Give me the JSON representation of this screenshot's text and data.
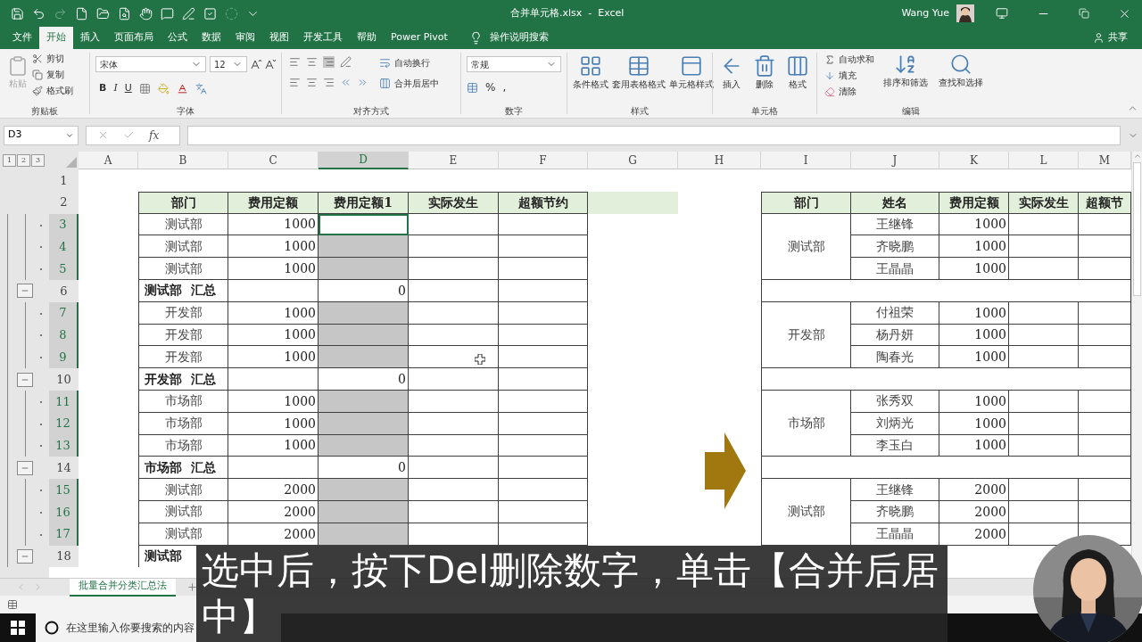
{
  "window": {
    "title": "合并单元格.xlsx  -  Excel",
    "user": "Wang Yue"
  },
  "ribbon_tabs": [
    {
      "label": "文件",
      "selected": false
    },
    {
      "label": "开始",
      "selected": true
    },
    {
      "label": "插入",
      "selected": false
    },
    {
      "label": "页面布局",
      "selected": false
    },
    {
      "label": "公式",
      "selected": false
    },
    {
      "label": "数据",
      "selected": false
    },
    {
      "label": "审阅",
      "selected": false
    },
    {
      "label": "视图",
      "selected": false
    },
    {
      "label": "开发工具",
      "selected": false
    },
    {
      "label": "帮助",
      "selected": false
    },
    {
      "label": "Power Pivot",
      "selected": false
    }
  ],
  "tell_me": "操作说明搜索",
  "share": "共享",
  "clipboard": {
    "title": "剪贴板",
    "paste": "粘贴",
    "commands": [
      "剪切",
      "复制",
      "格式刷"
    ]
  },
  "font": {
    "title": "字体",
    "family": "宋体",
    "size": "12",
    "styles": [
      "B",
      "I",
      "U"
    ]
  },
  "alignment": {
    "title": "对齐方式",
    "commands": [
      "自动换行",
      "合并后居中"
    ]
  },
  "number": {
    "title": "数字",
    "format": "常规",
    "symbols": [
      "%",
      ","
    ]
  },
  "styles": {
    "title": "样式",
    "commands": [
      "条件格式",
      "套用表格格式",
      "单元格样式"
    ]
  },
  "cells": {
    "title": "单元格",
    "commands": [
      "插入",
      "删除",
      "格式"
    ]
  },
  "editing": {
    "title": "编辑",
    "small": [
      "自动求和",
      "填充",
      "清除"
    ],
    "large": [
      "排序和筛选",
      "查找和选择"
    ]
  },
  "formula_bar": {
    "name_box": "D3",
    "fx": "fx"
  },
  "sheet": {
    "outline_levels": [
      "1",
      "2",
      "3"
    ],
    "columns": [
      {
        "label": "A",
        "selected": false
      },
      {
        "label": "B",
        "selected": false
      },
      {
        "label": "C",
        "selected": false
      },
      {
        "label": "D",
        "selected": true
      },
      {
        "label": "E",
        "selected": false
      },
      {
        "label": "F",
        "selected": false
      },
      {
        "label": "G",
        "selected": false
      },
      {
        "label": "H",
        "selected": false
      },
      {
        "label": "I",
        "selected": false
      },
      {
        "label": "J",
        "selected": false
      },
      {
        "label": "K",
        "selected": false
      },
      {
        "label": "L",
        "selected": false
      },
      {
        "label": "M",
        "selected": false
      }
    ],
    "rows": [
      {
        "number": "1",
        "selected": false
      },
      {
        "number": "2",
        "selected": false
      },
      {
        "number": "3",
        "selected": true,
        "kind": "detail"
      },
      {
        "number": "4",
        "selected": true,
        "kind": "detail"
      },
      {
        "number": "5",
        "selected": true,
        "kind": "detail"
      },
      {
        "number": "6",
        "selected": false,
        "kind": "collapse"
      },
      {
        "number": "7",
        "selected": true,
        "kind": "detail"
      },
      {
        "number": "8",
        "selected": true,
        "kind": "detail"
      },
      {
        "number": "9",
        "selected": true,
        "kind": "detail"
      },
      {
        "number": "10",
        "selected": false,
        "kind": "collapse"
      },
      {
        "number": "11",
        "selected": true,
        "kind": "detail"
      },
      {
        "number": "12",
        "selected": true,
        "kind": "detail"
      },
      {
        "number": "13",
        "selected": true,
        "kind": "detail"
      },
      {
        "number": "14",
        "selected": false,
        "kind": "collapse"
      },
      {
        "number": "15",
        "selected": true,
        "kind": "detail"
      },
      {
        "number": "16",
        "selected": true,
        "kind": "detail"
      },
      {
        "number": "17",
        "selected": true,
        "kind": "detail"
      },
      {
        "number": "18",
        "selected": false,
        "kind": "collapse"
      }
    ]
  },
  "left_table": {
    "header": [
      "部门",
      "费用定额",
      "费用定额1",
      "实际发生",
      "超额节约"
    ],
    "rows": [
      {
        "kind": "detail",
        "dept": "测试部",
        "quota": "1000",
        "quota1": "",
        "selected": true,
        "active": true
      },
      {
        "kind": "detail",
        "dept": "测试部",
        "quota": "1000",
        "quota1": "",
        "selected": true,
        "active": false
      },
      {
        "kind": "detail",
        "dept": "测试部",
        "quota": "1000",
        "quota1": "",
        "selected": true,
        "active": false
      },
      {
        "kind": "subtotal",
        "dept": "测试部  汇总",
        "quota": "",
        "quota1": "0",
        "selected": false,
        "active": false
      },
      {
        "kind": "detail",
        "dept": "开发部",
        "quota": "1000",
        "quota1": "",
        "selected": true,
        "active": false
      },
      {
        "kind": "detail",
        "dept": "开发部",
        "quota": "1000",
        "quota1": "",
        "selected": true,
        "active": false
      },
      {
        "kind": "detail",
        "dept": "开发部",
        "quota": "1000",
        "quota1": "",
        "selected": true,
        "active": false
      },
      {
        "kind": "subtotal",
        "dept": "开发部  汇总",
        "quota": "",
        "quota1": "0",
        "selected": false,
        "active": false
      },
      {
        "kind": "detail",
        "dept": "市场部",
        "quota": "1000",
        "quota1": "",
        "selected": true,
        "active": false
      },
      {
        "kind": "detail",
        "dept": "市场部",
        "quota": "1000",
        "quota1": "",
        "selected": true,
        "active": false
      },
      {
        "kind": "detail",
        "dept": "市场部",
        "quota": "1000",
        "quota1": "",
        "selected": true,
        "active": false
      },
      {
        "kind": "subtotal",
        "dept": "市场部  汇总",
        "quota": "",
        "quota1": "0",
        "selected": false,
        "active": false
      },
      {
        "kind": "detail",
        "dept": "测试部",
        "quota": "2000",
        "quota1": "",
        "selected": true,
        "active": false
      },
      {
        "kind": "detail",
        "dept": "测试部",
        "quota": "2000",
        "quota1": "",
        "selected": true,
        "active": false
      },
      {
        "kind": "detail",
        "dept": "测试部",
        "quota": "2000",
        "quota1": "",
        "selected": true,
        "active": false
      },
      {
        "kind": "partial",
        "dept": "测试部"
      }
    ]
  },
  "right_table": {
    "header": [
      "部门",
      "姓名",
      "费用定额",
      "实际发生",
      "超额节"
    ],
    "groups": [
      {
        "dept": "测试部",
        "rows": [
          {
            "name": "王继锋",
            "quota": "1000"
          },
          {
            "name": "齐晓鹏",
            "quota": "1000"
          },
          {
            "name": "王晶晶",
            "quota": "1000"
          }
        ]
      },
      {
        "dept": "开发部",
        "rows": [
          {
            "name": "付祖荣",
            "quota": "1000"
          },
          {
            "name": "杨丹妍",
            "quota": "1000"
          },
          {
            "name": "陶春光",
            "quota": "1000"
          }
        ]
      },
      {
        "dept": "市场部",
        "rows": [
          {
            "name": "张秀双",
            "quota": "1000"
          },
          {
            "name": "刘炳光",
            "quota": "1000"
          },
          {
            "name": "李玉白",
            "quota": "1000"
          }
        ]
      },
      {
        "dept": "测试部",
        "rows": [
          {
            "name": "王继锋",
            "quota": "2000"
          },
          {
            "name": "齐晓鹏",
            "quota": "2000"
          },
          {
            "name": "王晶晶",
            "quota": "2000"
          }
        ]
      }
    ]
  },
  "sheet_tabs": [
    {
      "label": "批量合并分类汇总法",
      "selected": true
    }
  ],
  "taskbar": {
    "search_placeholder": "在这里输入你要搜索的内容"
  },
  "caption": "选中后，按下Del删除数字，单击【合并后居中】"
}
